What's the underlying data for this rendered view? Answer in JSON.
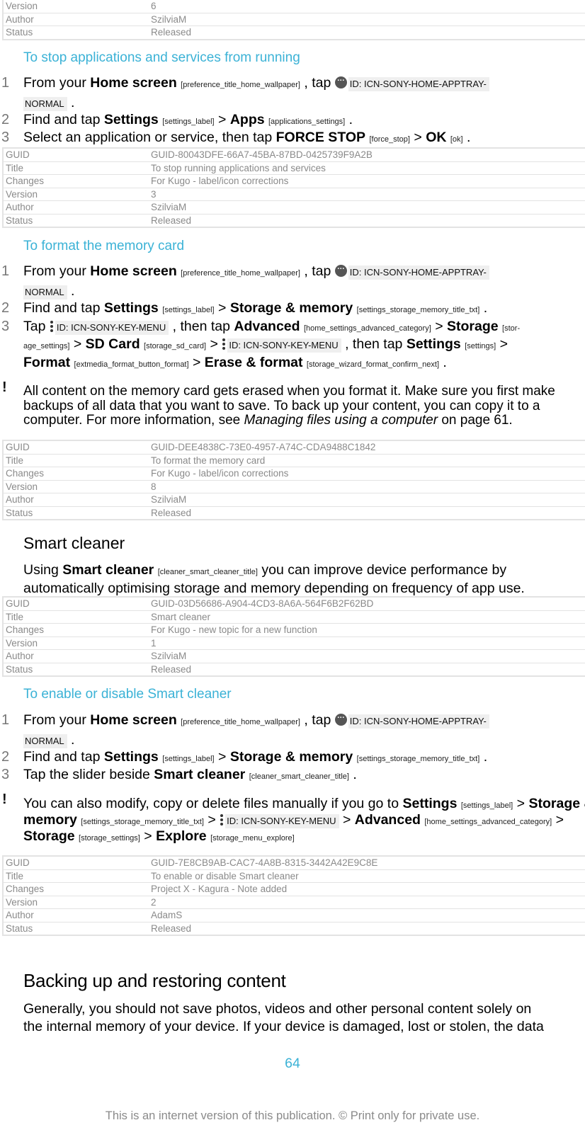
{
  "meta_labels": {
    "guid": "GUID",
    "title": "Title",
    "changes": "Changes",
    "version": "Version",
    "author": "Author",
    "status": "Status"
  },
  "top_table": {
    "version": "6",
    "author": "SzilviaM",
    "status": "Released"
  },
  "icons": {
    "apptray_id": "ID: ICN-SONY-HOME-APPTRAY-",
    "apptray_id_cont": "NORMAL",
    "key_menu_id": "ID: ICN-SONY-KEY-MENU"
  },
  "section_stop": {
    "heading": "To stop applications and services from running",
    "step1": {
      "num": "1",
      "pre": "From your ",
      "b1": "Home screen",
      "t1": "[preference_title_home_wallpaper]",
      "mid": " , tap ",
      "end": " ."
    },
    "step2": {
      "num": "2",
      "pre": "Find and tap ",
      "b1": "Settings",
      "t1": "[settings_label]",
      "sep": " > ",
      "b2": "Apps",
      "t2": "[applications_settings]",
      "end": " ."
    },
    "step3": {
      "num": "3",
      "pre": "Select an application or service, then tap ",
      "b1": "FORCE STOP",
      "t1": "[force_stop]",
      "sep": " > ",
      "b2": "OK",
      "t2": "[ok]",
      "end": " ."
    },
    "meta": {
      "guid": "GUID-80043DFE-66A7-45BA-87BD-0425739F9A2B",
      "title": "To stop running applications and services",
      "changes": "For Kugo - label/icon corrections",
      "version": "3",
      "author": "SzilviaM",
      "status": "Released"
    }
  },
  "section_format": {
    "heading": "To format the memory card",
    "step1": {
      "num": "1",
      "pre": "From your ",
      "b1": "Home screen",
      "t1": "[preference_title_home_wallpaper]",
      "mid": " , tap ",
      "end": " ."
    },
    "step2": {
      "num": "2",
      "pre": "Find and tap ",
      "b1": "Settings",
      "t1": "[settings_label]",
      "sep": " > ",
      "b2": "Storage & memory",
      "t2": "[settings_storage_memory_title_txt]",
      "end": " ."
    },
    "step3": {
      "num": "3",
      "pre": "Tap ",
      "mid1": " , then tap ",
      "b1": "Advanced",
      "t1": "[home_settings_advanced_category]",
      "sep": " > ",
      "b2": "Storage",
      "t2a": "[stor-",
      "t2b": "age_settings]",
      "b3": "SD Card",
      "t3": "[storage_sd_card]",
      "mid2": " , then tap ",
      "b4": "Settings",
      "t4": "[settings]",
      "b5": "Format",
      "t5": "[extmedia_format_button_format]",
      "b6": "Erase & format",
      "t6": "[storage_wizard_format_confirm_next]",
      "end": " ."
    },
    "note": {
      "icon": "!",
      "text1": "All content on the memory card gets erased when you format it. Make sure you first make backups of all data that you want to save. To back up your content, you can copy it to a computer. For more information, see ",
      "link": "Managing files using a computer",
      "text2": " on page 61."
    },
    "meta": {
      "guid": "GUID-DEE4838C-73E0-4957-A74C-CDA9488C1842",
      "title": "To format the memory card",
      "changes": "For Kugo - label/icon corrections",
      "version": "8",
      "author": "SzilviaM",
      "status": "Released"
    }
  },
  "section_smart": {
    "heading": "Smart cleaner",
    "intro": {
      "pre": "Using ",
      "b1": "Smart cleaner",
      "t1": "[cleaner_smart_cleaner_title]",
      "post1": " you can improve device performance by",
      "line2": "automatically optimising storage and memory depending on frequency of app use."
    },
    "meta": {
      "guid": "GUID-03D56686-A904-4CD3-8A6A-564F6B2F62BD",
      "title": "Smart cleaner",
      "changes": "For Kugo - new topic for a new function",
      "version": "1",
      "author": "SzilviaM",
      "status": "Released"
    }
  },
  "section_enable": {
    "heading": "To enable or disable Smart cleaner",
    "step1": {
      "num": "1",
      "pre": "From your ",
      "b1": "Home screen",
      "t1": "[preference_title_home_wallpaper]",
      "mid": " , tap ",
      "end": " ."
    },
    "step2": {
      "num": "2",
      "pre": "Find and tap ",
      "b1": "Settings",
      "t1": "[settings_label]",
      "sep": " > ",
      "b2": "Storage & memory",
      "t2": "[settings_storage_memory_title_txt]",
      "end": " ."
    },
    "step3": {
      "num": "3",
      "pre": "Tap the slider beside ",
      "b1": "Smart cleaner",
      "t1": "[cleaner_smart_cleaner_title]",
      "end": " ."
    },
    "note": {
      "icon": "!",
      "pre": "You can also modify, copy or delete files manually if you go to ",
      "b1": "Settings",
      "t1": "[settings_label]",
      "sep": " > ",
      "b2a": "Storage &",
      "b2b": "memory",
      "t2": "[settings_storage_memory_title_txt]",
      "b3": "Advanced",
      "t3": "[home_settings_advanced_category]",
      "b4": "Storage",
      "t4": "[storage_settings]",
      "b5": "Explore",
      "t5": "[storage_menu_explore]"
    },
    "meta": {
      "guid": "GUID-7E8CB9AB-CAC7-4A8B-8315-3442A42E9C8E",
      "title": "To enable or disable Smart cleaner",
      "changes": "Project X - Kagura - Note added",
      "version": "2",
      "author": "AdamS",
      "status": "Released"
    }
  },
  "section_backup": {
    "heading": "Backing up and restoring content",
    "line1": "Generally, you should not save photos, videos and other personal content solely on",
    "line2": "the internal memory of your device. If your device is damaged, lost or stolen, the data"
  },
  "page_number": "64",
  "footer": "This is an internet version of this publication. © Print only for private use."
}
